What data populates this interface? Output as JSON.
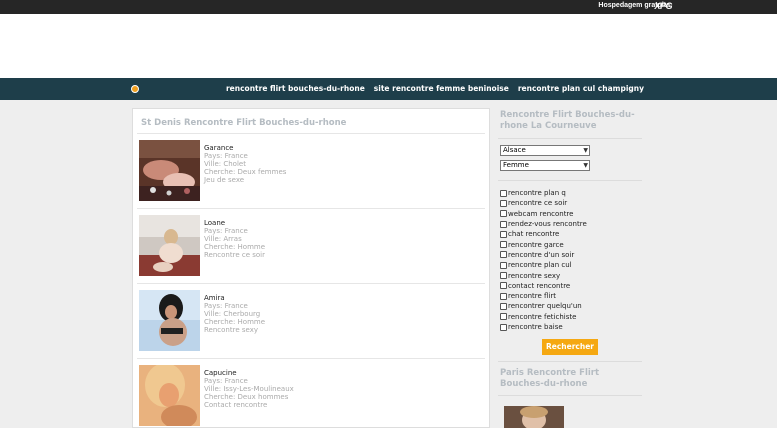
{
  "topbar": {
    "hosting_text": "Hospedagem gratuita",
    "logo_text": "XPG"
  },
  "nav": {
    "links": [
      "rencontre flirt bouches-du-rhone",
      "site rencontre femme beninoise",
      "rencontre plan cul champigny"
    ]
  },
  "main": {
    "title": "St Denis Rencontre Flirt Bouches-du-rhone",
    "profiles": [
      {
        "name": "Garance",
        "pays": "Pays: France",
        "ville": "Ville: Cholet",
        "cherche": "Cherche: Deux femmes",
        "tag": "Jeu de sexe"
      },
      {
        "name": "Loane",
        "pays": "Pays: France",
        "ville": "Ville: Arras",
        "cherche": "Cherche: Homme",
        "tag": "Rencontre ce soir"
      },
      {
        "name": "Amira",
        "pays": "Pays: France",
        "ville": "Ville: Cherbourg",
        "cherche": "Cherche: Homme",
        "tag": "Rencontre sexy"
      },
      {
        "name": "Capucine",
        "pays": "Pays: France",
        "ville": "Ville: Issy-Les-Moulineaux",
        "cherche": "Cherche: Deux hommes",
        "tag": "Contact rencontre"
      }
    ]
  },
  "sidebar": {
    "title": "Rencontre Flirt Bouches-du-rhone La Courneuve",
    "region_select": "Alsace",
    "gender_select": "Femme",
    "checkboxes": [
      "rencontre plan q",
      "rencontre ce soir",
      "webcam rencontre",
      "rendez-vous rencontre",
      "chat rencontre",
      "rencontre garce",
      "rencontre d'un soir",
      "rencontre plan cul",
      "rencontre sexy",
      "contact rencontre",
      "rencontre flirt",
      "rencontrer quelqu'un",
      "rencontre fetichiste",
      "rencontre baise"
    ],
    "search_label": "Rechercher",
    "second_title": "Paris Rencontre Flirt Bouches-du-rhone"
  },
  "colors": {
    "topbar": "#262626",
    "navbar": "#1e3e4a",
    "accent_button": "#f5a812",
    "title_gray": "#b5bcc2"
  }
}
